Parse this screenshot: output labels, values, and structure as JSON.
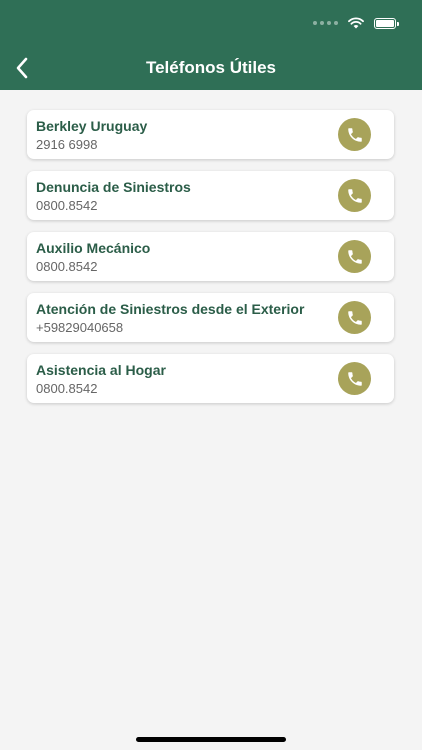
{
  "header": {
    "title": "Teléfonos Útiles",
    "background_color": "#2f6f56"
  },
  "contacts": [
    {
      "name": "Berkley Uruguay",
      "phone": "2916 6998"
    },
    {
      "name": "Denuncia de Siniestros",
      "phone": "0800.8542"
    },
    {
      "name": "Auxilio Mecánico",
      "phone": "0800.8542"
    },
    {
      "name": "Atención de Siniestros desde el Exterior",
      "phone": "+59829040658"
    },
    {
      "name": "Asistencia al Hogar",
      "phone": "0800.8542"
    }
  ],
  "call_button_color": "#a8a35a",
  "icons": {
    "back": "chevron-left-icon",
    "call": "phone-icon",
    "wifi": "wifi-icon",
    "battery": "battery-icon",
    "signal": "signal-icon"
  }
}
